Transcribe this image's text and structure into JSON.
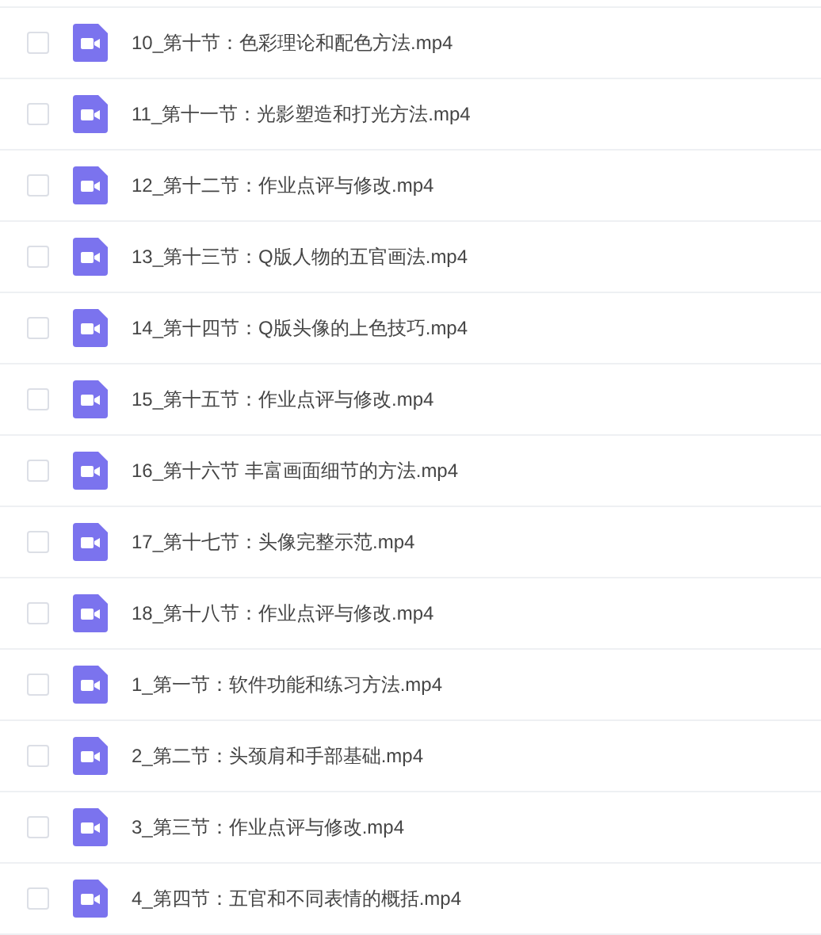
{
  "files": [
    {
      "name": "10_第十节：色彩理论和配色方法.mp4",
      "checked": false
    },
    {
      "name": "11_第十一节：光影塑造和打光方法.mp4",
      "checked": false
    },
    {
      "name": "12_第十二节：作业点评与修改.mp4",
      "checked": false
    },
    {
      "name": "13_第十三节：Q版人物的五官画法.mp4",
      "checked": false
    },
    {
      "name": "14_第十四节：Q版头像的上色技巧.mp4",
      "checked": false
    },
    {
      "name": "15_第十五节：作业点评与修改.mp4",
      "checked": false
    },
    {
      "name": "16_第十六节 丰富画面细节的方法.mp4",
      "checked": false
    },
    {
      "name": "17_第十七节：头像完整示范.mp4",
      "checked": false
    },
    {
      "name": "18_第十八节：作业点评与修改.mp4",
      "checked": false
    },
    {
      "name": "1_第一节：软件功能和练习方法.mp4",
      "checked": false
    },
    {
      "name": "2_第二节：头颈肩和手部基础.mp4",
      "checked": false
    },
    {
      "name": "3_第三节：作业点评与修改.mp4",
      "checked": false
    },
    {
      "name": "4_第四节：五官和不同表情的概括.mp4",
      "checked": false
    }
  ]
}
